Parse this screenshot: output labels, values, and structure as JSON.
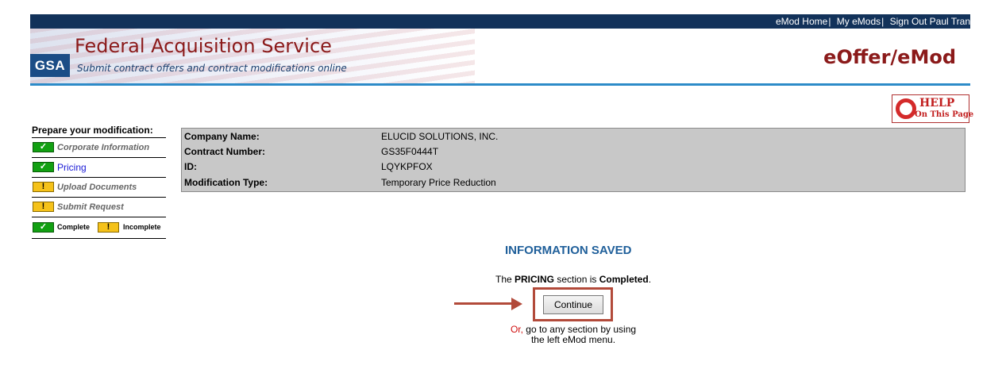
{
  "topnav": {
    "emod_home": "eMod Home",
    "my_emods": "My eMods",
    "sign_out": "Sign Out Paul Tran",
    "sep": "|"
  },
  "header": {
    "logo": "GSA",
    "title": "Federal Acquisition Service",
    "subtitle": "Submit contract offers and contract modifications online",
    "app_name": "eOffer/eMod"
  },
  "help": {
    "line1": "HELP",
    "line2": "On This Page"
  },
  "menu": {
    "title": "Prepare your modification:",
    "items": [
      {
        "label": "Corporate Information",
        "status": "complete"
      },
      {
        "label": "Pricing",
        "status": "complete"
      },
      {
        "label": "Upload Documents",
        "status": "incomplete"
      },
      {
        "label": "Submit Request",
        "status": "incomplete"
      }
    ],
    "legend_complete": "Complete",
    "legend_incomplete": "Incomplete"
  },
  "info": {
    "rows": [
      {
        "key": "Company Name:",
        "value": "ELUCID SOLUTIONS, INC."
      },
      {
        "key": "Contract Number:",
        "value": "GS35F0444T"
      },
      {
        "key": "ID:",
        "value": "LQYKPFOX"
      },
      {
        "key": "Modification Type:",
        "value": "Temporary Price Reduction"
      }
    ]
  },
  "saved": {
    "title": "INFORMATION SAVED",
    "msg_prefix": "The ",
    "msg_section": "PRICING",
    "msg_middle": " section is ",
    "msg_status": "Completed",
    "msg_suffix": ".",
    "continue_label": "Continue",
    "or_label": "Or,",
    "or_text1": " go to any section by using",
    "or_text2": "the left eMod menu."
  },
  "colors": {
    "nav_bar": "#12325a",
    "brand_red": "#8b1a1a",
    "accent_blue": "#2d8bc8",
    "complete_green": "#12a012",
    "incomplete_yellow": "#f5c21a",
    "highlight": "#b24a3a"
  }
}
